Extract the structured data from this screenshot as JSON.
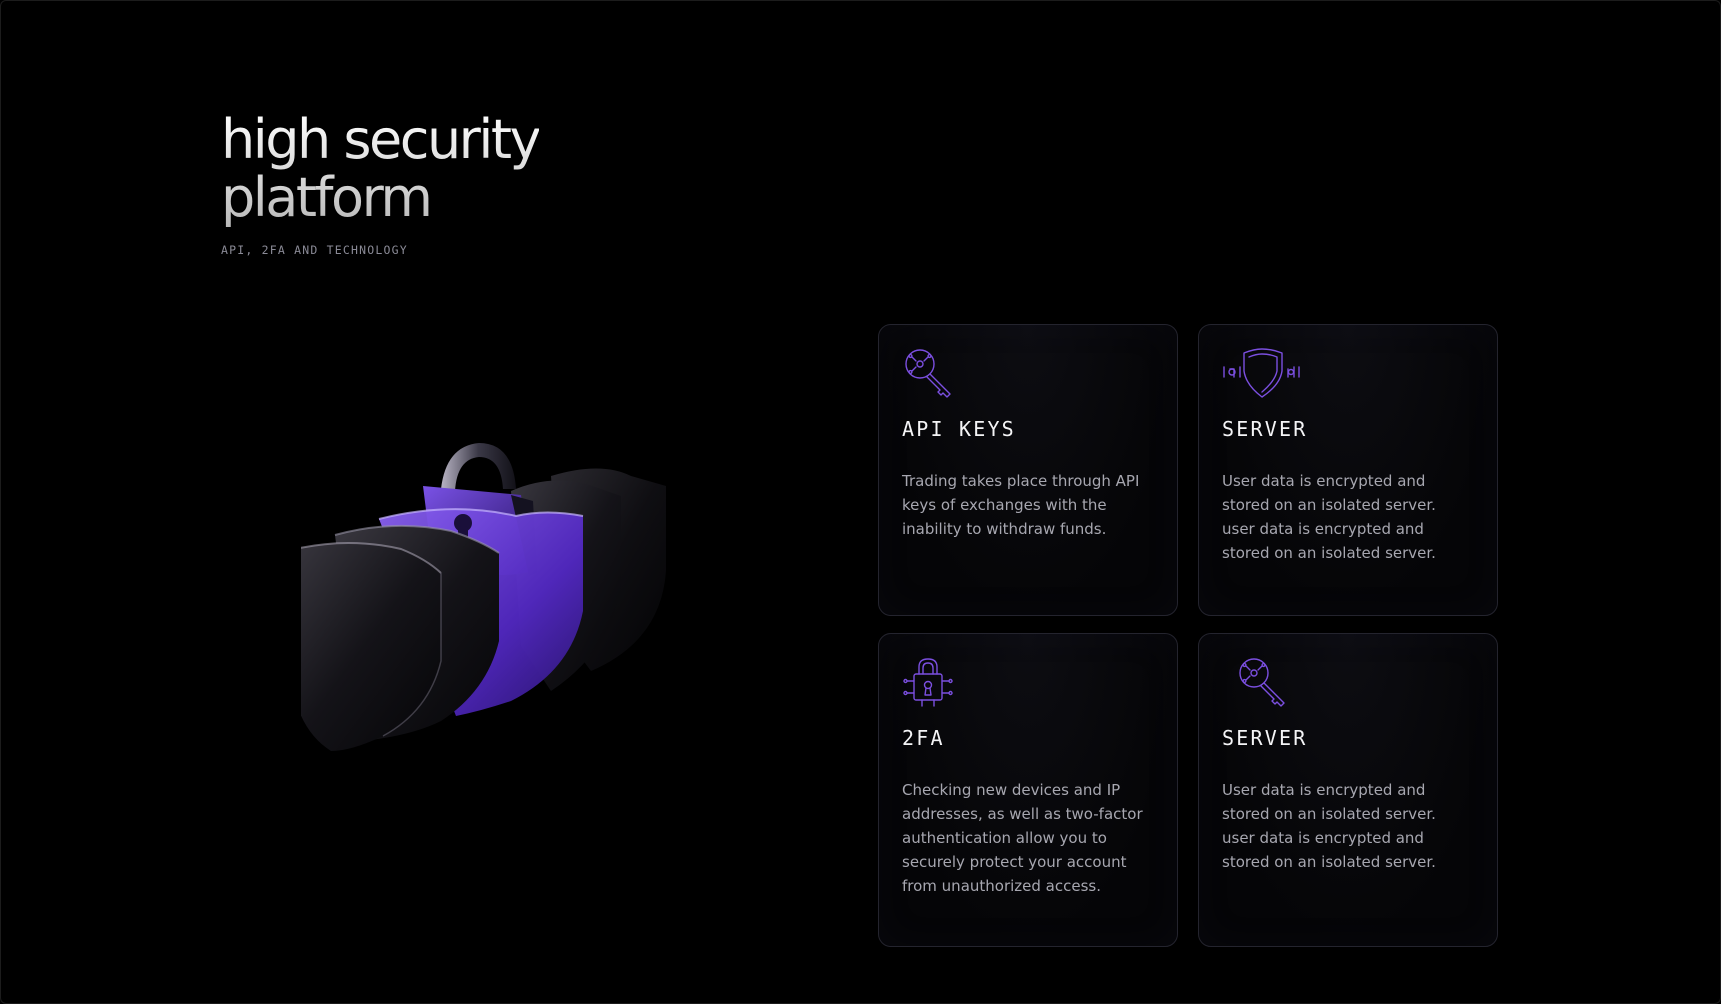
{
  "hero": {
    "title_line1": "high security",
    "title_line2": "platform",
    "subtitle": "API, 2FA AND TECHNOLOGY"
  },
  "colors": {
    "background": "#000000",
    "accent": "#7b4fe0",
    "card_border": "#24242e",
    "card_text": "#a7a7b0"
  },
  "illustration": {
    "icon": "shield-lock-icon"
  },
  "cards": [
    {
      "icon": "key-circuit-icon",
      "title": "API KEYS",
      "text": "Trading takes place through API keys of exchanges with the inability to withdraw funds."
    },
    {
      "icon": "binary-shield-icon",
      "title": "SERVER",
      "text": "User data is encrypted and stored on an isolated server. user data is encrypted and stored on an isolated server."
    },
    {
      "icon": "padlock-circuit-icon",
      "title": "2FA",
      "text": "Checking new devices and IP addresses, as well as two-factor authentication allow you to securely protect your account from unauthorized access."
    },
    {
      "icon": "key-circuit-icon",
      "title": "SERVER",
      "text": "User data is encrypted and stored on an isolated server. user data is encrypted and stored on an isolated server."
    }
  ]
}
